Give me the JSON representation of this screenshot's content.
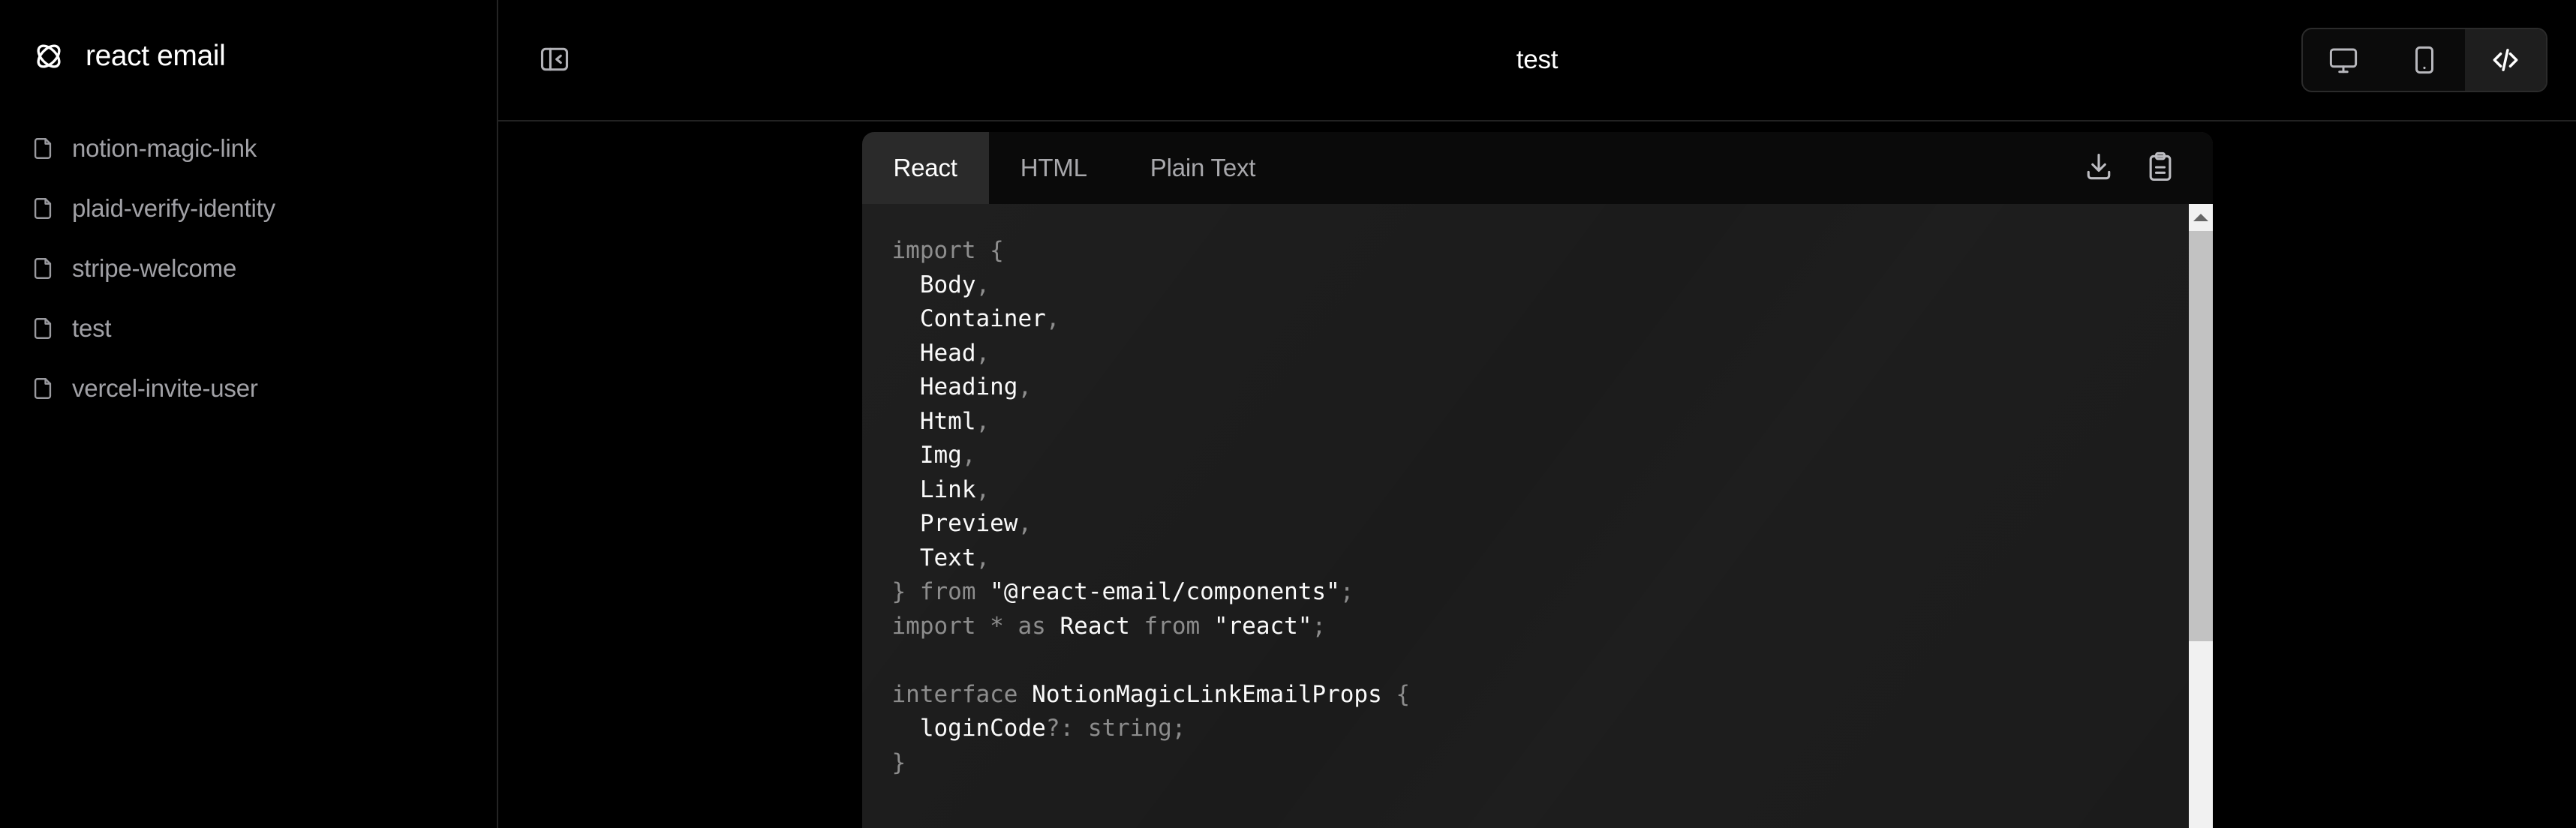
{
  "app": {
    "brand_name": "react email",
    "logo_icon": "atom-logo-icon"
  },
  "sidebar": {
    "items": [
      {
        "label": "notion-magic-link",
        "icon": "file-icon"
      },
      {
        "label": "plaid-verify-identity",
        "icon": "file-icon"
      },
      {
        "label": "stripe-welcome",
        "icon": "file-icon"
      },
      {
        "label": "test",
        "icon": "file-icon"
      },
      {
        "label": "vercel-invite-user",
        "icon": "file-icon"
      }
    ]
  },
  "topbar": {
    "collapse_icon": "panel-collapse-left-icon",
    "title": "test",
    "view_modes": [
      {
        "name": "desktop",
        "icon": "desktop-monitor-icon",
        "active": false
      },
      {
        "name": "mobile",
        "icon": "mobile-phone-icon",
        "active": false
      },
      {
        "name": "source",
        "icon": "code-brackets-icon",
        "active": true
      }
    ]
  },
  "code_panel": {
    "tabs": [
      {
        "label": "React",
        "active": true
      },
      {
        "label": "HTML",
        "active": false
      },
      {
        "label": "Plain Text",
        "active": false
      }
    ],
    "actions": [
      {
        "name": "download",
        "icon": "download-icon"
      },
      {
        "name": "copy",
        "icon": "clipboard-icon"
      }
    ],
    "language": "tsx",
    "code_lines": [
      "import {",
      "  Body,",
      "  Container,",
      "  Head,",
      "  Heading,",
      "  Html,",
      "  Img,",
      "  Link,",
      "  Preview,",
      "  Text,",
      "} from \"@react-email/components\";",
      "import * as React from \"react\";",
      "",
      "interface NotionMagicLinkEmailProps {",
      "  loginCode?: string;",
      "}"
    ],
    "scrollbar": {
      "up_arrow": "scroll-up-arrow",
      "thumb_position": "top"
    }
  },
  "colors": {
    "background": "#000000",
    "sidebar_border": "#242424",
    "panel_background": "#1b1b1b",
    "tabbar_background": "#0a0a0a",
    "active_tab_background": "#2a2a2a",
    "text_primary": "#ffffff",
    "text_muted": "#a1a1a6",
    "keyword": "#8c8c8c",
    "scrollbar_track": "#f1f1f1",
    "scrollbar_thumb": "#c2c2c2"
  }
}
